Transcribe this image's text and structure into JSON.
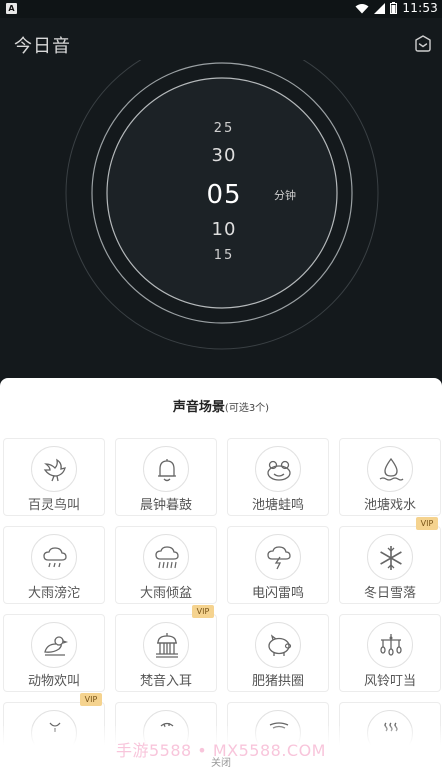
{
  "status_bar": {
    "time": "11:53",
    "app_badge": "A"
  },
  "header": {
    "title": "今日音"
  },
  "timer": {
    "values": [
      "25",
      "30",
      "05",
      "10",
      "15"
    ],
    "selected": "05",
    "unit": "分钟"
  },
  "sheet": {
    "title": "声音场景",
    "subtitle": "(可选3个)",
    "vip_label": "VIP",
    "scenes": [
      {
        "label": "百灵鸟叫",
        "icon": "bird-icon",
        "vip": false
      },
      {
        "label": "晨钟暮鼓",
        "icon": "bell-icon",
        "vip": false
      },
      {
        "label": "池塘蛙鸣",
        "icon": "frog-icon",
        "vip": false
      },
      {
        "label": "池塘戏水",
        "icon": "water-drop-icon",
        "vip": false
      },
      {
        "label": "大雨滂沱",
        "icon": "rain-cloud-icon",
        "vip": false
      },
      {
        "label": "大雨倾盆",
        "icon": "heavy-rain-icon",
        "vip": false
      },
      {
        "label": "电闪雷鸣",
        "icon": "thunder-icon",
        "vip": false
      },
      {
        "label": "冬日雪落",
        "icon": "snowflake-icon",
        "vip": true
      },
      {
        "label": "动物欢叫",
        "icon": "bird-perched-icon",
        "vip": false
      },
      {
        "label": "梵音入耳",
        "icon": "temple-icon",
        "vip": true
      },
      {
        "label": "肥猪拱圈",
        "icon": "pig-icon",
        "vip": false
      },
      {
        "label": "风铃叮当",
        "icon": "wind-chime-icon",
        "vip": false
      },
      {
        "label": "",
        "icon": "partial-icon",
        "vip": true
      },
      {
        "label": "",
        "icon": "partial-icon",
        "vip": false
      },
      {
        "label": "",
        "icon": "partial-icon",
        "vip": false
      },
      {
        "label": "",
        "icon": "steam-icon",
        "vip": false
      }
    ],
    "watermark": "手游5588 • MX5588.COM",
    "close_label": "关闭"
  }
}
